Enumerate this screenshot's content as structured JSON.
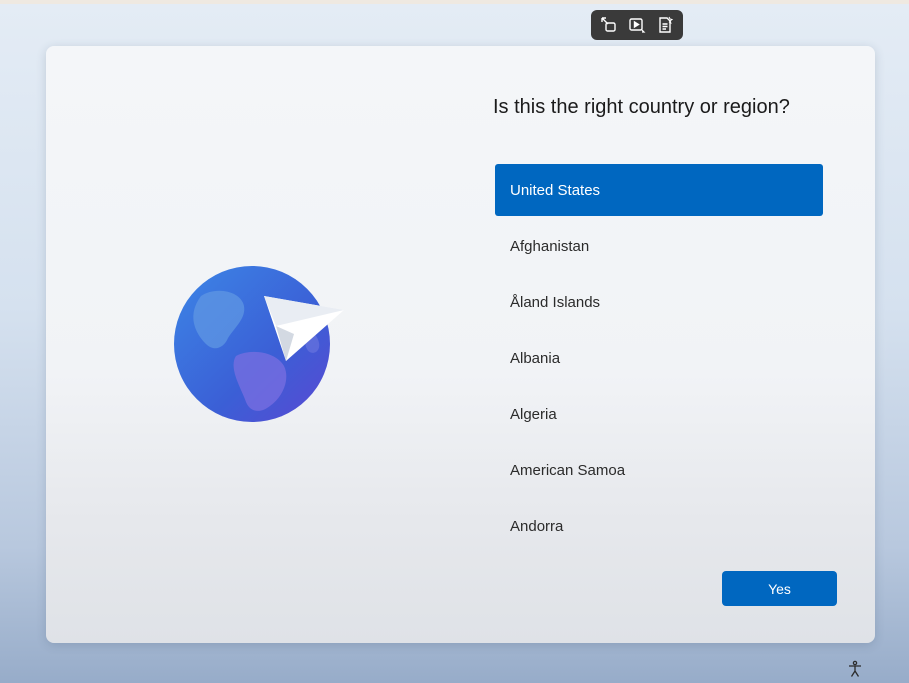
{
  "toolbar": {
    "icons": [
      "screenshot-capture-icon",
      "video-capture-icon",
      "notes-icon"
    ]
  },
  "setup": {
    "question": "Is this the right country or region?",
    "countries": [
      {
        "label": "United States",
        "selected": true
      },
      {
        "label": "Afghanistan",
        "selected": false
      },
      {
        "label": "Åland Islands",
        "selected": false
      },
      {
        "label": "Albania",
        "selected": false
      },
      {
        "label": "Algeria",
        "selected": false
      },
      {
        "label": "American Samoa",
        "selected": false
      },
      {
        "label": "Andorra",
        "selected": false
      }
    ],
    "yes_label": "Yes"
  },
  "colors": {
    "accent": "#0067c0",
    "globe": "#3f6fd8",
    "toolbar_bg": "#3a3a3a"
  },
  "footer": {
    "icon": "accessibility-icon"
  }
}
